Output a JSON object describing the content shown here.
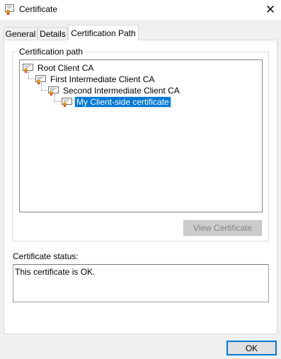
{
  "window": {
    "title": "Certificate",
    "close_glyph": "✕"
  },
  "tabs": [
    {
      "label": "General",
      "active": false
    },
    {
      "label": "Details",
      "active": false
    },
    {
      "label": "Certification Path",
      "active": true
    }
  ],
  "certification_path": {
    "group_label": "Certification path",
    "items": [
      {
        "label": "Root Client CA",
        "level": 0,
        "selected": false
      },
      {
        "label": "First Intermediate Client CA",
        "level": 1,
        "selected": false
      },
      {
        "label": "Second Intermediate Client CA",
        "level": 2,
        "selected": false
      },
      {
        "label": "My Client-side certificate",
        "level": 3,
        "selected": true
      }
    ],
    "view_button": {
      "label": "View Certificate",
      "enabled": false
    }
  },
  "status": {
    "label": "Certificate status:",
    "text": "This certificate is OK."
  },
  "footer": {
    "ok_label": "OK"
  },
  "icons": {
    "title": "certificate-icon",
    "tree_item": "certificate-icon"
  },
  "colors": {
    "selection": "#0078d7",
    "dialog_background": "#f0f0f0"
  }
}
